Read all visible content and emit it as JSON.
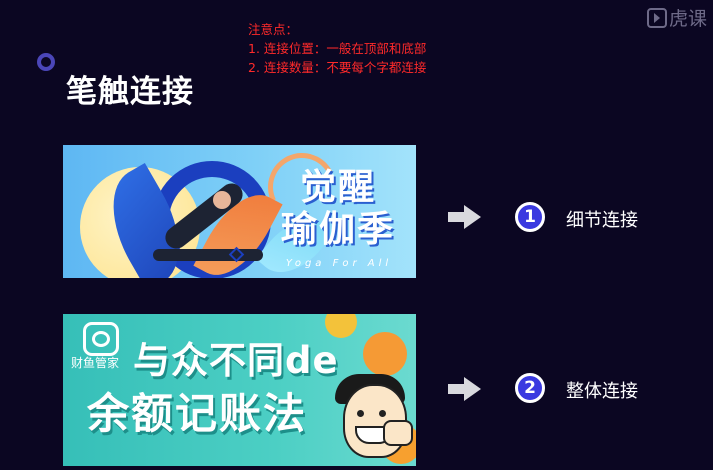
{
  "page": {
    "title": "笔触连接",
    "notes": {
      "heading": "注意点：",
      "items": [
        "1. 连接位置：一般在顶部和底部",
        "2. 连接数量：不要每个字都连接"
      ]
    },
    "watermark": "虎课"
  },
  "examples": [
    {
      "banner": {
        "title_line1": "觉醒",
        "title_line2": "瑜伽季",
        "subtitle": "Yoga For All"
      },
      "number": "1",
      "label": "细节连接"
    },
    {
      "banner": {
        "brand": "财鱼管家",
        "title_line1": "与众不同de",
        "title_line2": "余额记账法"
      },
      "number": "2",
      "label": "整体连接"
    }
  ],
  "colors": {
    "background": "#0b0622",
    "notes": "#ff2a2a",
    "badge": "#3a39e0",
    "arrow": "#d9d9de"
  }
}
